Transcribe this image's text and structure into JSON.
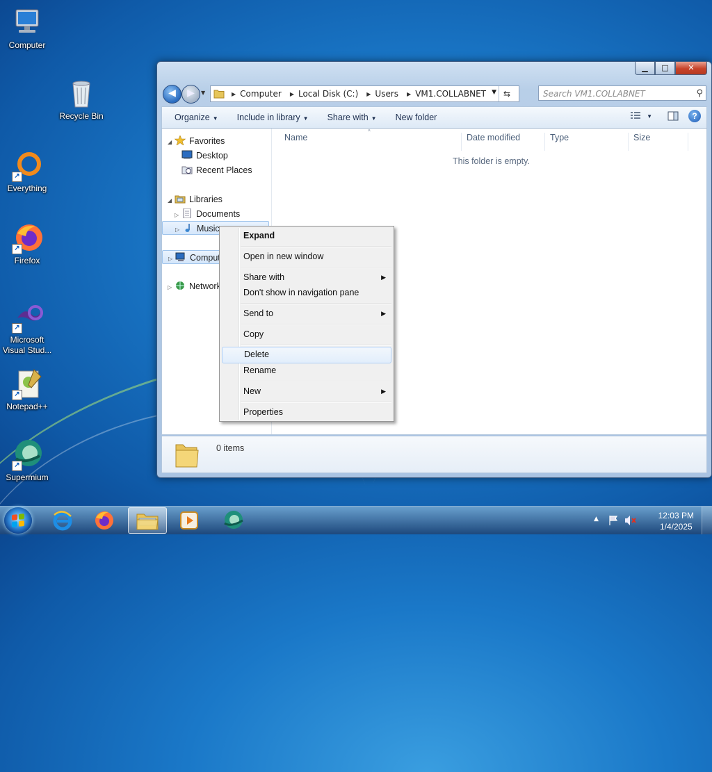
{
  "desktop_icons": [
    {
      "label": "Computer"
    },
    {
      "label": "Recycle Bin"
    },
    {
      "label": "Everything"
    },
    {
      "label": "Firefox"
    },
    {
      "label": "Microsoft Visual Stud..."
    },
    {
      "label": "Notepad++"
    },
    {
      "label": "Supermium"
    }
  ],
  "explorer": {
    "caption_buttons": {
      "minimize": "▁",
      "maximize": "□",
      "close": "✕"
    },
    "address": {
      "crumbs": [
        "Computer",
        "Local Disk (C:)",
        "Users",
        "VM1.COLLABNET"
      ]
    },
    "search_placeholder": "Search VM1.COLLABNET",
    "toolbar": {
      "organize": "Organize",
      "include_in_library": "Include in library",
      "share_with": "Share with",
      "new_folder": "New folder"
    },
    "nav": {
      "favorites": "Favorites",
      "desktop": "Desktop",
      "recent_places": "Recent Places",
      "libraries": "Libraries",
      "documents": "Documents",
      "music": "Music",
      "computer": "Comput",
      "network": "Network"
    },
    "columns": {
      "name": "Name",
      "date_modified": "Date modified",
      "type": "Type",
      "size": "Size"
    },
    "empty_message": "This folder is empty.",
    "details": {
      "item_count": "0 items"
    }
  },
  "context_menu": {
    "expand": "Expand",
    "open_new_window": "Open in new window",
    "share_with": "Share with",
    "dont_show": "Don't show in navigation pane",
    "send_to": "Send to",
    "copy": "Copy",
    "delete": "Delete",
    "rename": "Rename",
    "new": "New",
    "properties": "Properties",
    "highlighted": "Delete"
  },
  "taskbar": {
    "time": "12:03 PM",
    "date": "1/4/2025"
  }
}
